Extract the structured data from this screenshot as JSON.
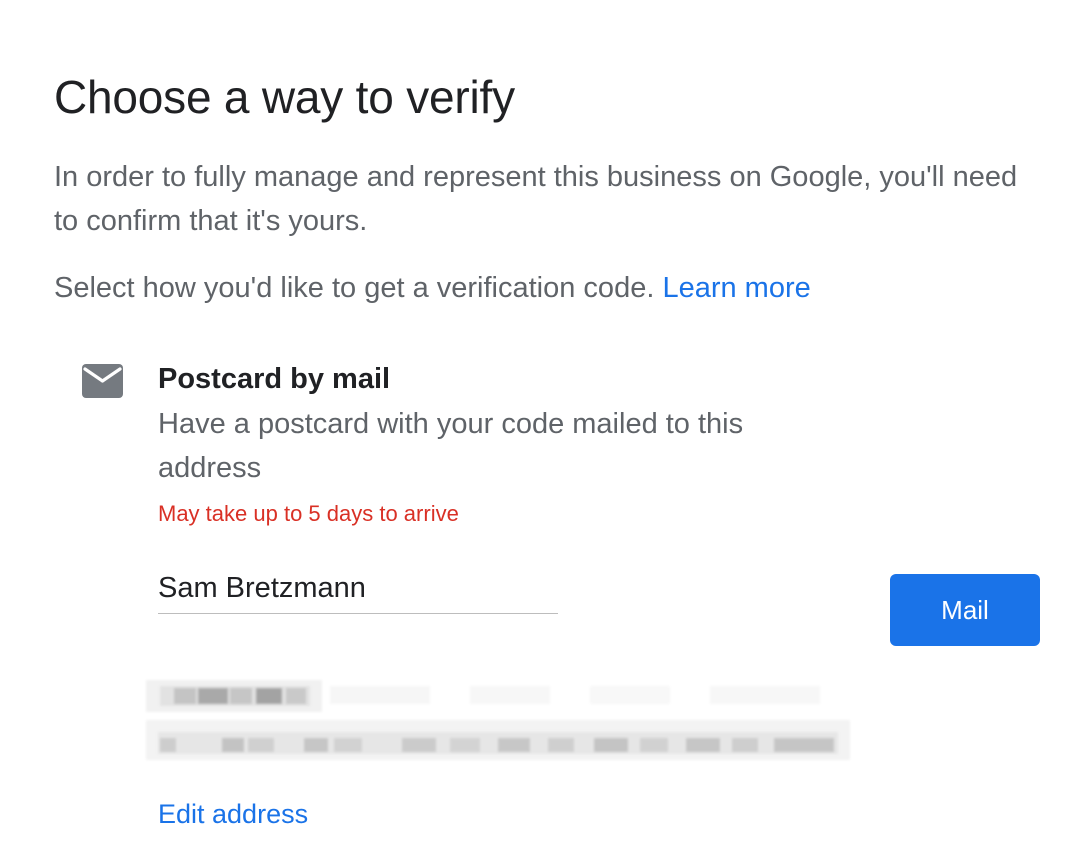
{
  "header": {
    "title": "Choose a way to verify",
    "intro": "In order to fully manage and represent this business on Google, you'll need to confirm that it's yours.",
    "select_prompt": "Select how you'd like to get a verification code.",
    "learn_more": "Learn more"
  },
  "option": {
    "icon": "mail-icon",
    "title": "Postcard by mail",
    "description": "Have a postcard with your code mailed to this address",
    "warning": "May take up to 5 days to arrive",
    "name_value": "Sam Bretzmann",
    "action_label": "Mail",
    "edit_address_label": "Edit address"
  },
  "colors": {
    "accent": "#1a73e8",
    "warning": "#d93025",
    "secondary_text": "#5f6368",
    "primary_text": "#202124",
    "icon": "#757a80"
  }
}
